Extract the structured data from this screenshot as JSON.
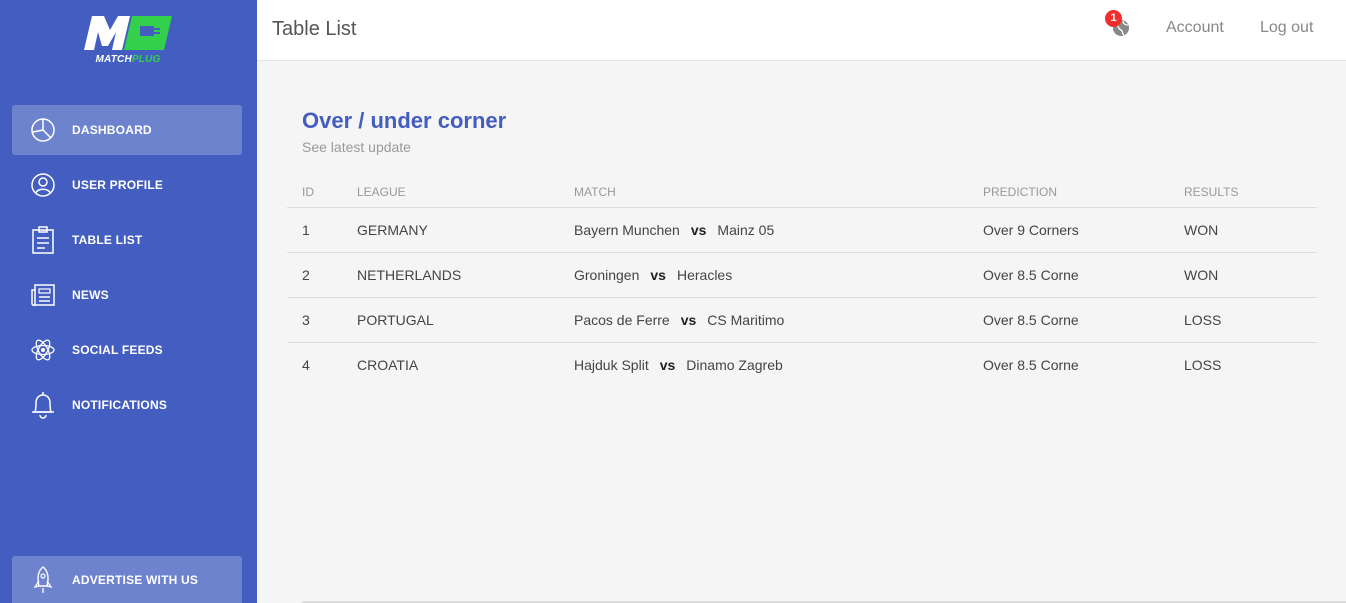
{
  "brand": {
    "logo_mark": "M",
    "name_main": "MATCH",
    "name_accent": "PLUG",
    "green": "#33d04c"
  },
  "colors": {
    "sidebar": "#435ec0",
    "accent": "#435ec0",
    "badge": "#ef2e2e"
  },
  "sidebar": {
    "items": [
      {
        "label": "DASHBOARD",
        "icon": "pie-chart-icon",
        "active": true
      },
      {
        "label": "USER PROFILE",
        "icon": "user-icon",
        "active": false
      },
      {
        "label": "TABLE LIST",
        "icon": "clipboard-icon",
        "active": false
      },
      {
        "label": "NEWS",
        "icon": "newspaper-icon",
        "active": false
      },
      {
        "label": "SOCIAL FEEDS",
        "icon": "atom-icon",
        "active": false
      },
      {
        "label": "NOTIFICATIONS",
        "icon": "bell-icon",
        "active": false
      }
    ],
    "advertise": {
      "label": "ADVERTISE WITH US",
      "icon": "rocket-icon"
    }
  },
  "header": {
    "title": "Table List",
    "notification_count": "1",
    "notification_icon": "globe-icon",
    "account_label": "Account",
    "logout_label": "Log out"
  },
  "card": {
    "title": "Over / under corner",
    "subtitle": "See latest update"
  },
  "table": {
    "columns": [
      "ID",
      "LEAGUE",
      "MATCH",
      "PREDICTION",
      "RESULTS"
    ],
    "vs_label": "vs",
    "rows": [
      {
        "id": "1",
        "league": "GERMANY",
        "home": "Bayern Munchen",
        "away": "Mainz 05",
        "prediction": "Over 9 Corners",
        "result": "WON"
      },
      {
        "id": "2",
        "league": "NETHERLANDS",
        "home": "Groningen",
        "away": "Heracles",
        "prediction": "Over 8.5 Corne",
        "result": "WON"
      },
      {
        "id": "3",
        "league": "PORTUGAL",
        "home": "Pacos de Ferre",
        "away": "CS Maritimo",
        "prediction": "Over 8.5 Corne",
        "result": "LOSS"
      },
      {
        "id": "4",
        "league": "CROATIA",
        "home": "Hajduk Split",
        "away": "Dinamo Zagreb",
        "prediction": "Over 8.5 Corne",
        "result": "LOSS"
      }
    ]
  }
}
